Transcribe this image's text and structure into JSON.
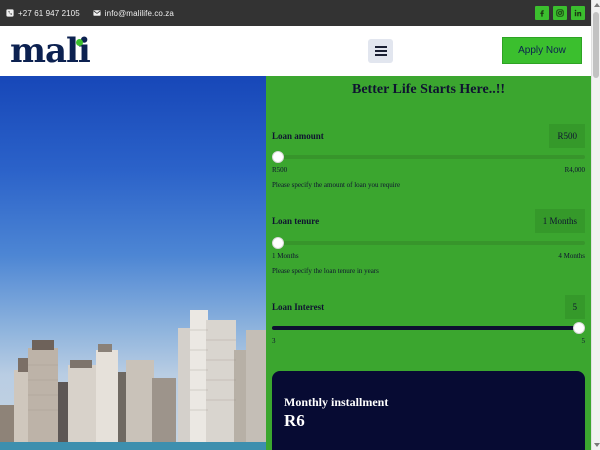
{
  "topbar": {
    "phone": "+27 61 947 2105",
    "email": "info@malilife.co.za",
    "phone_icon": "phone-icon",
    "email_icon": "mail-icon",
    "socials": [
      "facebook-icon",
      "instagram-icon",
      "linkedin-icon"
    ]
  },
  "header": {
    "logo_text": "mali",
    "apply_label": "Apply Now",
    "menu_icon": "hamburger-icon"
  },
  "calculator": {
    "title": "Better Life Starts Here..!!",
    "loan_amount": {
      "label": "Loan amount",
      "value": "R500",
      "min_label": "R500",
      "max_label": "R4,000",
      "hint": "Please specify the amount of loan you require",
      "fraction": 0
    },
    "loan_tenure": {
      "label": "Loan tenure",
      "value": "1 Months",
      "min_label": "1 Months",
      "max_label": "4 Months",
      "hint": "Please specify the loan tenure in years",
      "fraction": 0
    },
    "loan_interest": {
      "label": "Loan Interest",
      "value": "5",
      "min_label": "3",
      "max_label": "5",
      "fraction": 1
    },
    "monthly": {
      "title": "Monthly installment",
      "value": "R6"
    }
  },
  "colors": {
    "brand_green": "#3bbf2e",
    "calc_green": "#3ba62f",
    "navy": "#0c2150",
    "dark_panel": "#070b33"
  }
}
